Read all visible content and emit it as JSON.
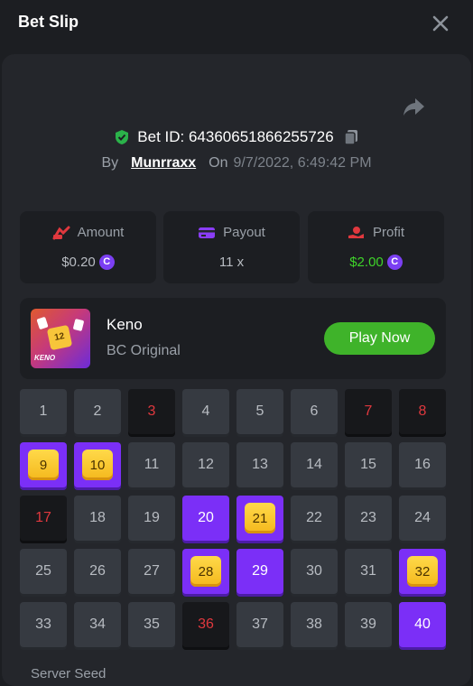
{
  "header": {
    "title": "Bet Slip"
  },
  "bet": {
    "id_text": "Bet ID: 64360651866255726",
    "by_label": "By",
    "username": "Munrraxx",
    "on_label": "On",
    "date": "9/7/2022, 6:49:42 PM"
  },
  "stats": {
    "amount": {
      "label": "Amount",
      "value": "$0.20"
    },
    "payout": {
      "label": "Payout",
      "value": "11 x"
    },
    "profit": {
      "label": "Profit",
      "value": "$2.00"
    }
  },
  "game": {
    "name": "Keno",
    "subtitle": "BC Original",
    "play_label": "Play Now",
    "thumb_tile": "12",
    "thumb_tag": "KENO"
  },
  "coin_symbol": "C",
  "colors": {
    "accent_purple": "#7b2ff7",
    "play_green": "#3fb32a",
    "miss_red": "#e0383e",
    "hit_gold": "#f4b81c",
    "profit_green": "#3fd32a"
  },
  "keno": {
    "cells": [
      {
        "n": "1",
        "state": "normal"
      },
      {
        "n": "2",
        "state": "normal"
      },
      {
        "n": "3",
        "state": "miss"
      },
      {
        "n": "4",
        "state": "normal"
      },
      {
        "n": "5",
        "state": "normal"
      },
      {
        "n": "6",
        "state": "normal"
      },
      {
        "n": "7",
        "state": "miss"
      },
      {
        "n": "8",
        "state": "miss"
      },
      {
        "n": "9",
        "state": "hit"
      },
      {
        "n": "10",
        "state": "hit"
      },
      {
        "n": "11",
        "state": "normal"
      },
      {
        "n": "12",
        "state": "normal"
      },
      {
        "n": "13",
        "state": "normal"
      },
      {
        "n": "14",
        "state": "normal"
      },
      {
        "n": "15",
        "state": "normal"
      },
      {
        "n": "16",
        "state": "normal"
      },
      {
        "n": "17",
        "state": "miss"
      },
      {
        "n": "18",
        "state": "normal"
      },
      {
        "n": "19",
        "state": "normal"
      },
      {
        "n": "20",
        "state": "pick"
      },
      {
        "n": "21",
        "state": "hit"
      },
      {
        "n": "22",
        "state": "normal"
      },
      {
        "n": "23",
        "state": "normal"
      },
      {
        "n": "24",
        "state": "normal"
      },
      {
        "n": "25",
        "state": "normal"
      },
      {
        "n": "26",
        "state": "normal"
      },
      {
        "n": "27",
        "state": "normal"
      },
      {
        "n": "28",
        "state": "hit"
      },
      {
        "n": "29",
        "state": "pick"
      },
      {
        "n": "30",
        "state": "normal"
      },
      {
        "n": "31",
        "state": "normal"
      },
      {
        "n": "32",
        "state": "hit"
      },
      {
        "n": "33",
        "state": "normal"
      },
      {
        "n": "34",
        "state": "normal"
      },
      {
        "n": "35",
        "state": "normal"
      },
      {
        "n": "36",
        "state": "miss"
      },
      {
        "n": "37",
        "state": "normal"
      },
      {
        "n": "38",
        "state": "normal"
      },
      {
        "n": "39",
        "state": "normal"
      },
      {
        "n": "40",
        "state": "pick"
      }
    ]
  },
  "seed": {
    "label": "Server Seed"
  }
}
